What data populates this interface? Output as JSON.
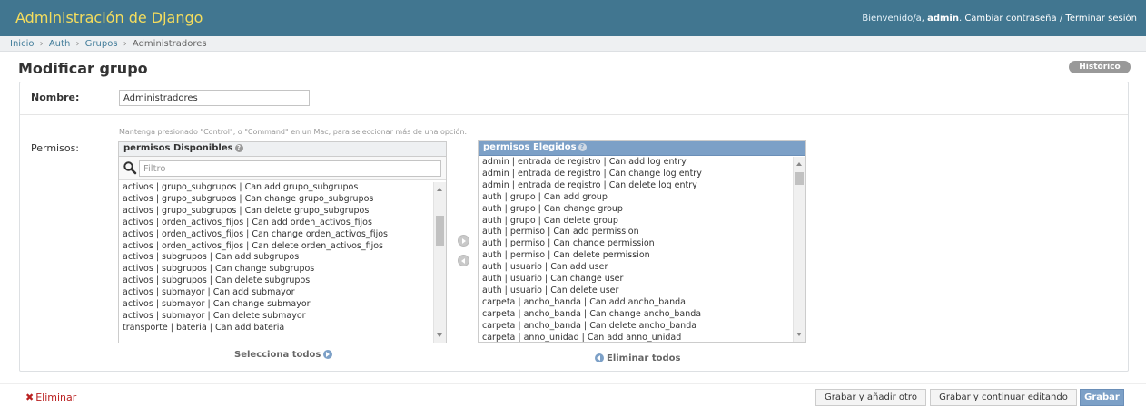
{
  "header": {
    "site_name": "Administración de Django",
    "welcome": "Bienvenido/a,",
    "username": "admin",
    "change_password": "Cambiar contraseña",
    "separator": "/",
    "logout": "Terminar sesión"
  },
  "breadcrumbs": {
    "home": "Inicio",
    "app": "Auth",
    "model": "Grupos",
    "current": "Administradores",
    "sep": "›"
  },
  "page": {
    "title": "Modificar grupo",
    "history": "Histórico"
  },
  "form": {
    "name_label": "Nombre:",
    "name_value": "Administradores",
    "perm_help": "Mantenga presionado \"Control\", o \"Command\" en un Mac, para seleccionar más de una opción.",
    "perm_label": "Permisos:"
  },
  "available": {
    "title": "permisos Disponibles",
    "filter_placeholder": "Filtro",
    "choose_all": "Selecciona todos",
    "items": [
      "activos | grupo_subgrupos | Can add grupo_subgrupos",
      "activos | grupo_subgrupos | Can change grupo_subgrupos",
      "activos | grupo_subgrupos | Can delete grupo_subgrupos",
      "activos | orden_activos_fijos | Can add orden_activos_fijos",
      "activos | orden_activos_fijos | Can change orden_activos_fijos",
      "activos | orden_activos_fijos | Can delete orden_activos_fijos",
      "activos | subgrupos | Can add subgrupos",
      "activos | subgrupos | Can change subgrupos",
      "activos | subgrupos | Can delete subgrupos",
      "activos | submayor | Can add submayor",
      "activos | submayor | Can change submayor",
      "activos | submayor | Can delete submayor",
      "transporte | bateria | Can add bateria"
    ]
  },
  "chosen": {
    "title": "permisos Elegidos",
    "clear_all": "Eliminar todos",
    "items": [
      "admin | entrada de registro | Can add log entry",
      "admin | entrada de registro | Can change log entry",
      "admin | entrada de registro | Can delete log entry",
      "auth | grupo | Can add group",
      "auth | grupo | Can change group",
      "auth | grupo | Can delete group",
      "auth | permiso | Can add permission",
      "auth | permiso | Can change permission",
      "auth | permiso | Can delete permission",
      "auth | usuario | Can add user",
      "auth | usuario | Can change user",
      "auth | usuario | Can delete user",
      "carpeta | ancho_banda | Can add ancho_banda",
      "carpeta | ancho_banda | Can change ancho_banda",
      "carpeta | ancho_banda | Can delete ancho_banda",
      "carpeta | anno_unidad | Can add anno_unidad"
    ]
  },
  "submit": {
    "delete": "Eliminar",
    "save_add": "Grabar y añadir otro",
    "save_continue": "Grabar y continuar editando",
    "save": "Grabar"
  },
  "colors": {
    "header_bg": "#417690",
    "site_name": "#f5dd5d",
    "accent": "#7ca0c7",
    "delete": "#ba2121"
  }
}
